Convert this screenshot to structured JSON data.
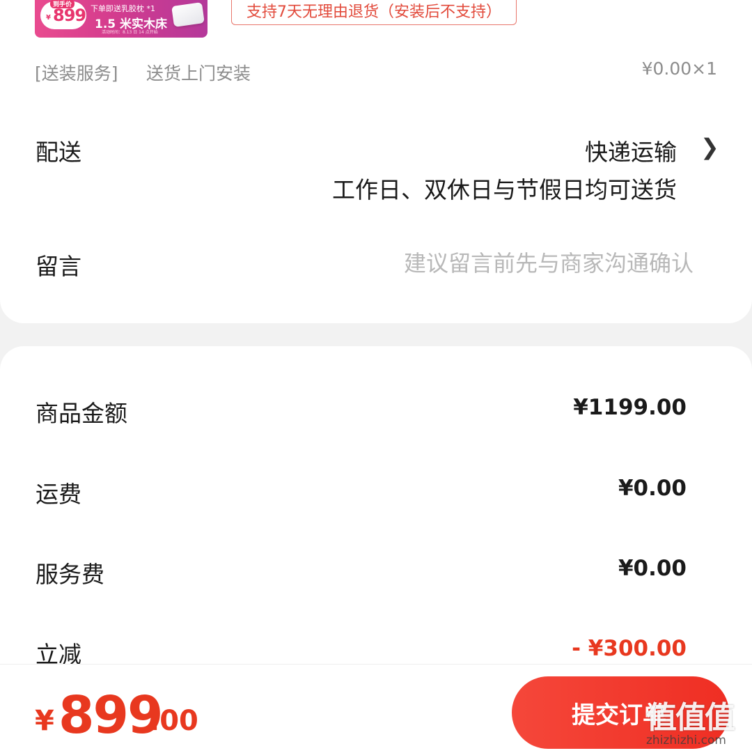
{
  "product": {
    "banner": {
      "price_tag": "到手价",
      "yen": "¥",
      "price": "899",
      "line1": "下单即送乳胶枕 *1",
      "line2": "1.5 米实木床",
      "line3": "活动时间：8.13 日 14 点开始"
    },
    "return_policy": "支持7天无理由退货（安装后不支持）"
  },
  "service": {
    "label": "[送装服务]",
    "name": "送货上门安装",
    "price": "¥0.00×1"
  },
  "delivery": {
    "label": "配送",
    "method": "快递运输",
    "note": "工作日、双休日与节假日均可送货"
  },
  "message": {
    "label": "留言",
    "placeholder": "建议留言前先与商家沟通确认"
  },
  "summary": {
    "goods_label": "商品金额",
    "goods_value": "¥1199.00",
    "shipping_label": "运费",
    "shipping_value": "¥0.00",
    "service_fee_label": "服务费",
    "service_fee_value": "¥0.00",
    "discount_label": "立减",
    "discount_value": "- ¥300.00"
  },
  "footer": {
    "total_yen": "¥",
    "total_int": "899",
    "total_dec": ".00",
    "submit_label": "提交订单"
  },
  "watermark": {
    "logo": "值值值",
    "url": "zhizhizhi.com"
  },
  "colors": {
    "accent": "#e8381f",
    "badge_border": "#e8756a"
  },
  "icons": {
    "chevron": "chevron-right-icon"
  }
}
